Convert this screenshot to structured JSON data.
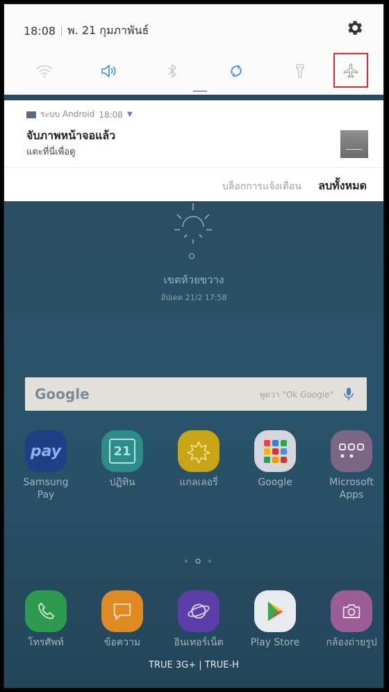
{
  "status_bar": {
    "time": "18:08",
    "date": "พ. 21 กุมภาพันธ์",
    "settings_icon": "gear-icon"
  },
  "quick_settings": [
    {
      "name": "wifi",
      "icon": "wifi-icon",
      "active": false
    },
    {
      "name": "sound",
      "icon": "volume-icon",
      "active": true
    },
    {
      "name": "bluetooth",
      "icon": "bluetooth-icon",
      "active": false
    },
    {
      "name": "auto-rotate",
      "icon": "rotate-icon",
      "active": true
    },
    {
      "name": "flashlight",
      "icon": "flashlight-icon",
      "active": false
    },
    {
      "name": "airplane-mode",
      "icon": "airplane-icon",
      "active": false
    }
  ],
  "notification": {
    "app": "ระบบ Android",
    "time": "18:08",
    "title": "จับภาพหน้าจอแล้ว",
    "subtitle": "แตะที่นี่เพื่อดู"
  },
  "actions": {
    "block": "บล็อกการแจ้งเตือน",
    "clear_all": "ลบทั้งหมด"
  },
  "weather": {
    "city": "เขตห้วยขวาง",
    "updated": "อัปเดต 21/2 17:58"
  },
  "search_bar": {
    "logo": "Google",
    "hint": "พูดว่า \"Ok Google\""
  },
  "apps_row1": [
    {
      "label": "Samsung Pay",
      "icon": "samsung-pay-icon"
    },
    {
      "label": "ปฏิทิน",
      "icon": "calendar-icon",
      "day": "21"
    },
    {
      "label": "แกลเลอรี่",
      "icon": "gallery-icon"
    },
    {
      "label": "Google",
      "icon": "google-folder-icon"
    },
    {
      "label": "Microsoft Apps",
      "icon": "microsoft-folder-icon"
    }
  ],
  "apps_dock": [
    {
      "label": "โทรศัพท์",
      "icon": "phone-icon"
    },
    {
      "label": "ข้อความ",
      "icon": "messages-icon"
    },
    {
      "label": "อินเทอร์เน็ต",
      "icon": "internet-icon"
    },
    {
      "label": "Play Store",
      "icon": "play-store-icon"
    },
    {
      "label": "กล้องถ่ายรูป",
      "icon": "camera-icon"
    }
  ],
  "carrier": "TRUE 3G+ | TRUE-H",
  "colors": {
    "accent": "#2f8fd8",
    "highlight": "#e02a2a"
  }
}
